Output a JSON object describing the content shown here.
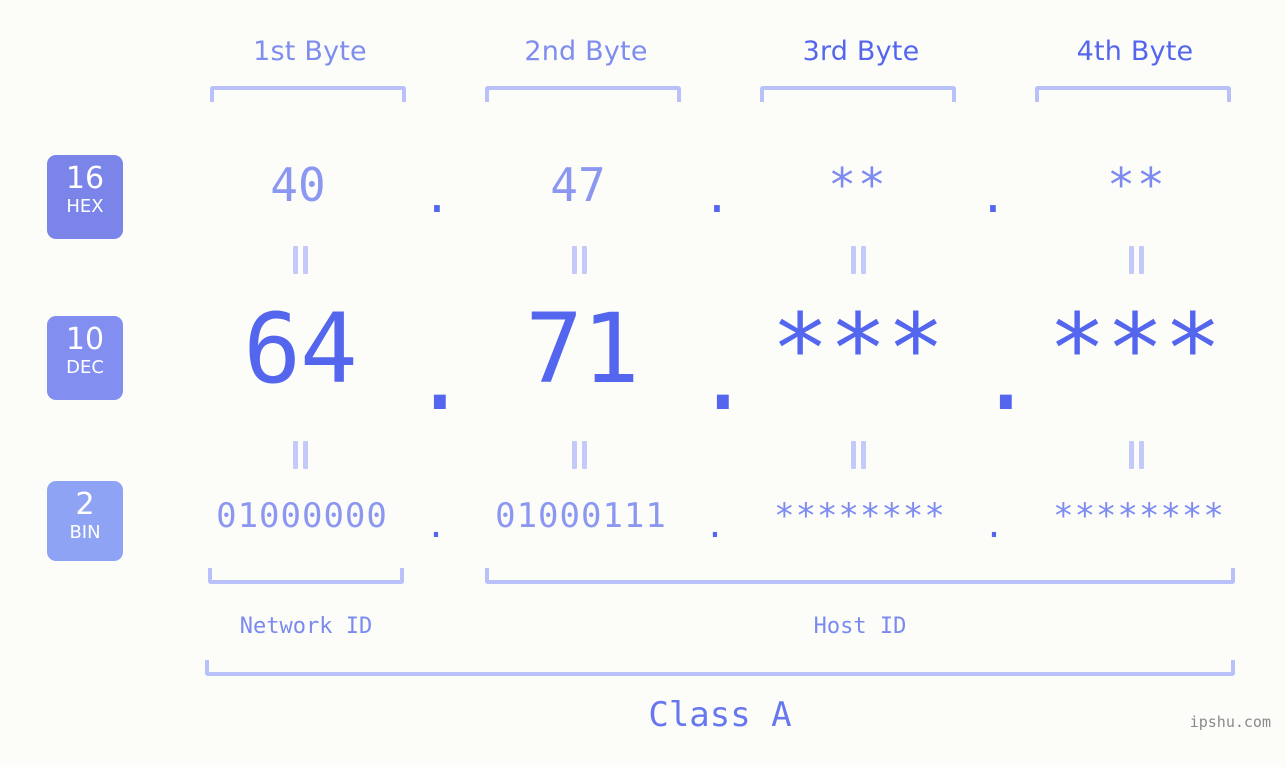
{
  "page": {
    "background_color": "#fcfdf9",
    "accent_color": "#5566ee",
    "accent_light_color": "#8c97f2",
    "bracket_color": "#b9c1fb",
    "watermark": "ipshu.com"
  },
  "byte_headers": [
    {
      "label": "1st Byte",
      "tone": "light"
    },
    {
      "label": "2nd Byte",
      "tone": "light"
    },
    {
      "label": "3rd Byte",
      "tone": "dark"
    },
    {
      "label": "4th Byte",
      "tone": "dark"
    }
  ],
  "radix_badges": [
    {
      "number": "16",
      "name": "HEX",
      "color": "#7b84e8"
    },
    {
      "number": "10",
      "name": "DEC",
      "color": "#828ef0"
    },
    {
      "number": "2",
      "name": "BIN",
      "color": "#8fa3f5"
    }
  ],
  "rows": {
    "hex": {
      "radix": "16",
      "radix_name": "HEX",
      "values": [
        "40",
        "47",
        "**",
        "**"
      ],
      "separator": "."
    },
    "dec": {
      "radix": "10",
      "radix_name": "DEC",
      "values": [
        "64",
        "71",
        "***",
        "***"
      ],
      "separator": "."
    },
    "bin": {
      "radix": "2",
      "radix_name": "BIN",
      "values": [
        "01000000",
        "01000111",
        "********",
        "********"
      ],
      "separator": "."
    }
  },
  "equals_marks": {
    "glyph": "=",
    "count_per_row": 4,
    "rows": [
      "hex-to-dec",
      "dec-to-bin"
    ]
  },
  "sections": {
    "network_id": "Network ID",
    "host_id": "Host ID",
    "class": "Class A"
  }
}
